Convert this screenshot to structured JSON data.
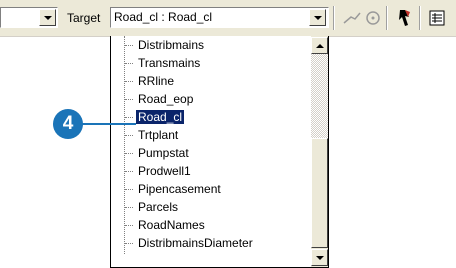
{
  "toolbar": {
    "target_label": "Target",
    "target_value": "Road_cl : Road_cl"
  },
  "dropdown": {
    "items": [
      "Distribmains",
      "Transmains",
      "RRline",
      "Road_eop",
      "Road_cl",
      "Trtplant",
      "Pumpstat",
      "Prodwell1",
      "Pipencasement",
      "Parcels",
      "RoadNames",
      "DistribmainsDiameter"
    ],
    "selected_item": "Road_cl"
  },
  "callout": {
    "step_number": "4",
    "color": "#1a74b8"
  },
  "icons": [
    "dropdown-arrow-icon",
    "sketch-tool-icon",
    "trace-tool-icon",
    "edit-tool-icon",
    "attributes-icon"
  ]
}
